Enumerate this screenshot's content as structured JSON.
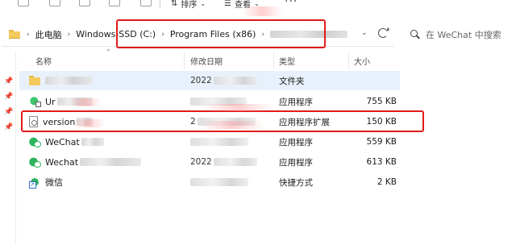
{
  "toolbar": {
    "sort_label": "排序",
    "view_label": "查看",
    "more_label": "···"
  },
  "address": {
    "segments": [
      "此电脑",
      "Windows-SSD (C:)",
      "Program Files (x86)"
    ],
    "chevron": "›"
  },
  "search": {
    "placeholder": "在 WeChat 中搜索"
  },
  "columns": {
    "name": "名称",
    "date": "修改日期",
    "type": "类型",
    "size": "大小"
  },
  "files": [
    {
      "name": "",
      "date": "2022",
      "type": "文件夹",
      "size": "",
      "icon": "folder-icon"
    },
    {
      "name": "Ur",
      "date": "",
      "type": "应用程序",
      "size": "755 KB",
      "icon": "app-icon"
    },
    {
      "name": "version",
      "date": "2",
      "type": "应用程序扩展",
      "size": "150 KB",
      "icon": "dll-icon"
    },
    {
      "name": "WeChat",
      "date": "",
      "type": "应用程序",
      "size": "559 KB",
      "icon": "wechat-icon"
    },
    {
      "name": "Wechat",
      "date": "2022",
      "type": "应用程序",
      "size": "613 KB",
      "icon": "wechat-icon"
    },
    {
      "name": "微信",
      "date": "",
      "type": "快捷方式",
      "size": "2 KB",
      "icon": "wechat-shortcut-icon"
    }
  ],
  "colors": {
    "highlight_box": "#e11b1b",
    "selected_row": "#e8f1fb",
    "folder": "#f4c95d",
    "wechat_green": "#2db55d"
  }
}
